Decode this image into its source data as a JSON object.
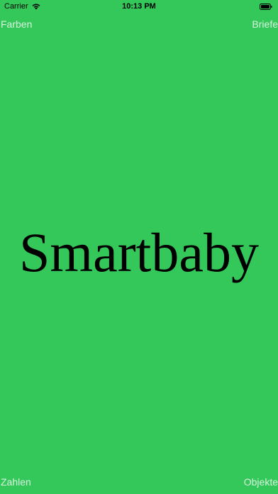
{
  "status_bar": {
    "carrier": "Carrier",
    "time": "10:13 PM",
    "icons": [
      "wifi-icon",
      "battery-icon"
    ]
  },
  "buttons": {
    "top_left": "Farben",
    "top_right": "Briefe",
    "bottom_left": "Zahlen",
    "bottom_right": "Objekte"
  },
  "main": {
    "title": "Smartbaby"
  },
  "colors": {
    "background": "#34c759",
    "button_text": "#d7f3df",
    "title_text": "#000000"
  }
}
